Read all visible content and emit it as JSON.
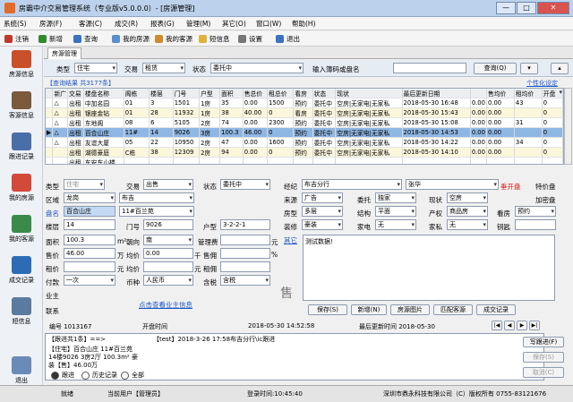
{
  "window": {
    "title": "房霸中介交易管理系统（专业版v5.0.0.0）- [房源管理]",
    "min": "—",
    "max": "□",
    "close": "✕"
  },
  "menu": [
    "系统(S)",
    "房源(F)",
    "客源(C)",
    "成交(R)",
    "报表(G)",
    "管理(M)",
    "其它(O)",
    "窗口(W)",
    "帮助(H)"
  ],
  "toolbar": {
    "logout": "注销",
    "new": "新增",
    "query": "查询",
    "my_houses": "我的房源",
    "my_clients": "我的客源",
    "sms": "短信息",
    "settings": "设置",
    "exit": "退出"
  },
  "nav": [
    "房源信息",
    "客源信息",
    "跟进记录",
    "我的房源",
    "我的客源",
    "成交记录",
    "短信息",
    "退出"
  ],
  "tab": "房源管理",
  "filter": {
    "type_label": "类型",
    "type_value": "住宅",
    "trade_label": "交易",
    "trade_value": "租赁",
    "status_label": "状态",
    "status_value": "委托中",
    "code_placeholder": "输入簿码或盘名",
    "query_btn": "查询(Q)"
  },
  "result": {
    "text": "【查询结果 共3177条】",
    "custom": "个性化设定"
  },
  "grid": {
    "headers": [
      "",
      "新广",
      "交易",
      "楼盘名称",
      "阁栋",
      "楼层",
      "门号",
      "户型",
      "面积",
      "售总价",
      "租总价",
      "看房",
      "状态",
      "现状",
      "最后更新日期",
      "",
      "售均价",
      "租均价",
      "开盘"
    ],
    "rows": [
      [
        "",
        "△",
        "出租",
        "中加名园",
        "01",
        "3",
        "1501",
        "1房",
        "35",
        "0.00",
        "1500",
        "预约",
        "委托中",
        "空房|无家电|无家私",
        "2018-05-30 16:48",
        "0.00",
        "0.00",
        "43",
        "0"
      ],
      [
        "",
        "△",
        "出租",
        "银座金钻",
        "01",
        "28",
        "11932",
        "1房",
        "38",
        "40.00",
        "0",
        "看房",
        "委托中",
        "空房|无家电|无家私",
        "2018-05-30 15:43",
        "0.00",
        "0.00",
        "",
        "0"
      ],
      [
        "",
        "△",
        "出租",
        "东地阁",
        "08",
        "6",
        "5105",
        "2房",
        "74",
        "0.00",
        "2300",
        "预约",
        "委托中",
        "空房|无家电|无家私",
        "2018-05-30 15:08",
        "0.00",
        "0.00",
        "31",
        "0"
      ],
      [
        "▶",
        "△",
        "出租",
        "百合山庄",
        "11#",
        "14",
        "9026",
        "3房",
        "100.3",
        "46.00",
        "0",
        "预约",
        "委托中",
        "空房|无家电|无家私",
        "2018-05-30 14:53",
        "0.00",
        "0.00",
        "",
        "0"
      ],
      [
        "",
        "△",
        "出租",
        "友谊大厦",
        "05",
        "22",
        "10950",
        "2房",
        "47",
        "0.00",
        "1600",
        "预约",
        "委托中",
        "空房|无家电|无家私",
        "2018-05-30 14:22",
        "0.00",
        "0.00",
        "34",
        "0"
      ],
      [
        "",
        "",
        "出租",
        "湖德豪庭",
        "C栋",
        "38",
        "12309",
        "2房",
        "94",
        "0.00",
        "0",
        "预约",
        "委托中",
        "空房|无家电|无家私",
        "2018-05-30 14:10",
        "0.00",
        "0.00",
        "",
        "0"
      ],
      [
        "",
        "",
        "出租",
        "东安东山楼",
        "",
        "",
        "",
        "",
        "",
        "",
        "",
        "",
        "",
        "",
        "",
        "",
        "",
        "",
        ""
      ]
    ]
  },
  "detail": {
    "type": "住宅",
    "trade": "出售",
    "status": "委托中",
    "manager": "布吉分行",
    "agent": "张华",
    "region": "龙岗",
    "area": "布吉",
    "estate": "百合山庄",
    "building": "11#百兰苑",
    "floor": "14",
    "door": "9026",
    "layout": "3-2-2-1",
    "sqm": "100.3",
    "orientation": "南",
    "mgmt_fee": "",
    "price": "46.00",
    "unit_price": "0.00",
    "rent": "",
    "rent_unit": "",
    "pay": "一次",
    "currency": "人民币",
    "tax": "含税",
    "labels": {
      "type": "类型",
      "trade": "交易",
      "status": "状态",
      "region": "区域",
      "estate": "盘名",
      "floor": "楼层",
      "door": "门号",
      "layout": "户型",
      "sqm": "面积",
      "sqm_unit": "m²",
      "orientation": "朝向",
      "mgmt": "管理费",
      "yuan": "元",
      "price": "售价",
      "wan": "万",
      "unit": "均价",
      "qian": "千",
      "rate": "售佣",
      "pct": "%",
      "rent": "租价",
      "rent_comm": "租佣",
      "pay": "付款",
      "currency": "币种",
      "tax": "含税",
      "owner": "业主",
      "contact": "联系",
      "manager": "经纪",
      "source": "来源",
      "entrust": "委托",
      "current": "现状",
      "house_type": "房型",
      "structure": "结构",
      "title": "产权",
      "viewing": "看房",
      "decor": "装修",
      "appliance": "家电",
      "furniture": "家私",
      "key": "钥匙",
      "remark": "其它",
      "rent_lbl": "元",
      "hand": "手"
    },
    "right": {
      "source": "广告",
      "entrust": "独家",
      "current": "空房",
      "house_type": "多层",
      "structure": "平面",
      "title": "商品房",
      "viewing": "预约",
      "decor": "豪装",
      "appliance": "无",
      "furniture": "无"
    },
    "open_sale": "垂开盘",
    "special": "特价盘",
    "encrypted": "加密盘",
    "remark_text": "测试数据!",
    "owner_link": "点击查看业主信息",
    "stamp": "售",
    "buttons": [
      "保存(S)",
      "新增(N)",
      "房源图片",
      "匹配客源",
      "成交记录"
    ],
    "footer": {
      "code": "编号 1013167",
      "open": "开盘时间",
      "open_date": "2018-05-30 14:52:58",
      "last": "最后更新时间 2018-05-30"
    }
  },
  "follow": {
    "header": "【跟进共1条】==>",
    "entry": "【test】2018-3-26 17:58布吉分行\\ic跟进",
    "line1": "【住宅】百合山庄 11#百兰苑",
    "line2": "14楼9026 3房2厅 100.3m² 豪",
    "line3": "装【售】46.00万",
    "write_btn": "写跟进(F)",
    "save_btn": "保存(S)",
    "cancel_btn": "取消(C)",
    "radio": [
      "跟进",
      "历史记录",
      "全部"
    ]
  },
  "status": {
    "ready": "就绪",
    "user": "当前用户【管理员】",
    "login": "登录时间:10:45:40",
    "company": "深圳市鼎永科技有限公司（C）版权所有 0755-83121676"
  },
  "colors": {
    "title": "#bcd2ec",
    "selected": "#8fb7e3",
    "accent_red": "#d31a1a",
    "link": "#1a56c8"
  }
}
